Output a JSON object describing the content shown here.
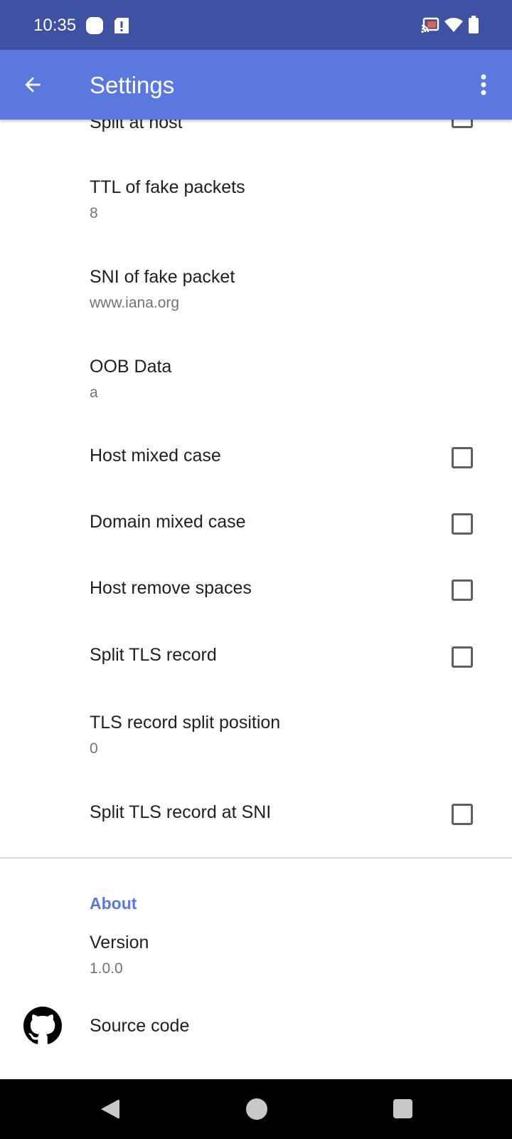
{
  "status_bar": {
    "time": "10:35",
    "icons_left": [
      "notification-square-icon",
      "alert-badge-icon"
    ],
    "icons_right": [
      "cast-icon",
      "wifi-icon",
      "battery-icon"
    ]
  },
  "app_bar": {
    "title": "Settings",
    "back_icon": "arrow-back-icon",
    "menu_icon": "more-vert-icon",
    "color": "#5a78de"
  },
  "preferences": [
    {
      "id": "split-at-host",
      "title": "Split at host",
      "summary": null,
      "has_checkbox": true,
      "checked": false
    },
    {
      "id": "ttl-fake-packets",
      "title": "TTL of fake packets",
      "summary": "8",
      "has_checkbox": false
    },
    {
      "id": "sni-fake-packet",
      "title": "SNI of fake packet",
      "summary": "www.iana.org",
      "has_checkbox": false
    },
    {
      "id": "oob-data",
      "title": "OOB Data",
      "summary": "a",
      "has_checkbox": false
    },
    {
      "id": "host-mixed-case",
      "title": "Host mixed case",
      "summary": null,
      "has_checkbox": true,
      "checked": false
    },
    {
      "id": "domain-mixed-case",
      "title": "Domain mixed case",
      "summary": null,
      "has_checkbox": true,
      "checked": false
    },
    {
      "id": "host-remove-spaces",
      "title": "Host remove spaces",
      "summary": null,
      "has_checkbox": true,
      "checked": false
    },
    {
      "id": "split-tls-record",
      "title": "Split TLS record",
      "summary": null,
      "has_checkbox": true,
      "checked": false
    },
    {
      "id": "tls-record-split-position",
      "title": "TLS record split position",
      "summary": "0",
      "has_checkbox": false
    },
    {
      "id": "split-tls-record-at-sni",
      "title": "Split TLS record at SNI",
      "summary": null,
      "has_checkbox": true,
      "checked": false
    }
  ],
  "about": {
    "category_title": "About",
    "version_title": "Version",
    "version_value": "1.0.0",
    "source_code_title": "Source code",
    "source_code_icon": "github-icon",
    "accent_color": "#5a78de"
  },
  "nav_bar": {
    "icons": [
      "nav-back-icon",
      "nav-home-icon",
      "nav-recents-icon"
    ]
  }
}
